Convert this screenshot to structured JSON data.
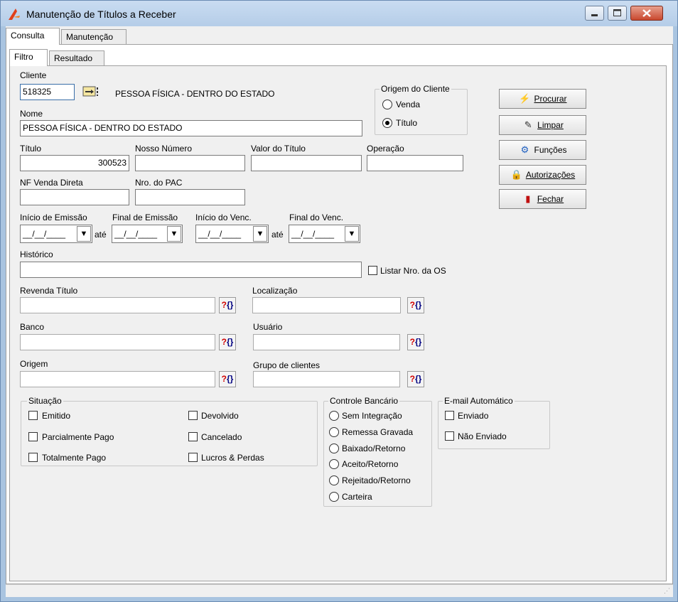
{
  "window": {
    "title": "Manutenção de Títulos a Receber"
  },
  "outer_tabs": [
    "Consulta",
    "Manutenção"
  ],
  "inner_tabs": [
    "Filtro",
    "Resultado"
  ],
  "cliente": {
    "label": "Cliente",
    "code": "518325",
    "name": "PESSOA FÍSICA - DENTRO DO ESTADO"
  },
  "nome": {
    "label": "Nome",
    "value": "PESSOA FÍSICA - DENTRO DO ESTADO"
  },
  "origem_cliente": {
    "title": "Origem do Cliente",
    "options": [
      "Venda",
      "Título"
    ],
    "selected": "Título"
  },
  "buttons": {
    "procurar": "Procurar",
    "limpar": "Limpar",
    "funcoes": "Funções",
    "autorizacoes": "Autorizações",
    "fechar": "Fechar"
  },
  "titulo": {
    "label": "Título",
    "value": "300523"
  },
  "nosso_numero": {
    "label": "Nosso Número",
    "value": ""
  },
  "valor_titulo": {
    "label": "Valor do Título",
    "value": ""
  },
  "operacao": {
    "label": "Operação",
    "value": ""
  },
  "nf_venda_direta": {
    "label": "NF Venda Direta",
    "value": ""
  },
  "nro_pac": {
    "label": "Nro. do PAC",
    "value": ""
  },
  "dates": {
    "inicio_emissao": {
      "label": "Início de Emissão",
      "value": "__/__/____"
    },
    "final_emissao": {
      "label": "Final de Emissão",
      "value": "__/__/____"
    },
    "inicio_venc": {
      "label": "Início do Venc.",
      "value": "__/__/____"
    },
    "final_venc": {
      "label": "Final do Venc.",
      "value": "__/__/____"
    },
    "ate": "até"
  },
  "historico": {
    "label": "Histórico",
    "value": ""
  },
  "listar_os": {
    "label": "Listar Nro. da OS",
    "checked": false
  },
  "revenda_titulo": {
    "label": "Revenda Título",
    "value": ""
  },
  "localizacao": {
    "label": "Localização",
    "value": ""
  },
  "banco": {
    "label": "Banco",
    "value": ""
  },
  "usuario": {
    "label": "Usuário",
    "value": ""
  },
  "origem": {
    "label": "Origem",
    "value": ""
  },
  "grupo_clientes": {
    "label": "Grupo de clientes",
    "value": ""
  },
  "lookup_glyph": {
    "q": "?",
    "b": "{}"
  },
  "situacao": {
    "title": "Situação",
    "left": [
      "Emitido",
      "Parcialmente Pago",
      "Totalmente Pago"
    ],
    "right": [
      "Devolvido",
      "Cancelado",
      "Lucros & Perdas"
    ]
  },
  "controle_bancario": {
    "title": "Controle Bancário",
    "options": [
      "Sem Integração",
      "Remessa Gravada",
      "Baixado/Retorno",
      "Aceito/Retorno",
      "Rejeitado/Retorno",
      "Carteira"
    ]
  },
  "email_automatico": {
    "title": "E-mail Automático",
    "options": [
      "Enviado",
      "Não Enviado"
    ]
  }
}
